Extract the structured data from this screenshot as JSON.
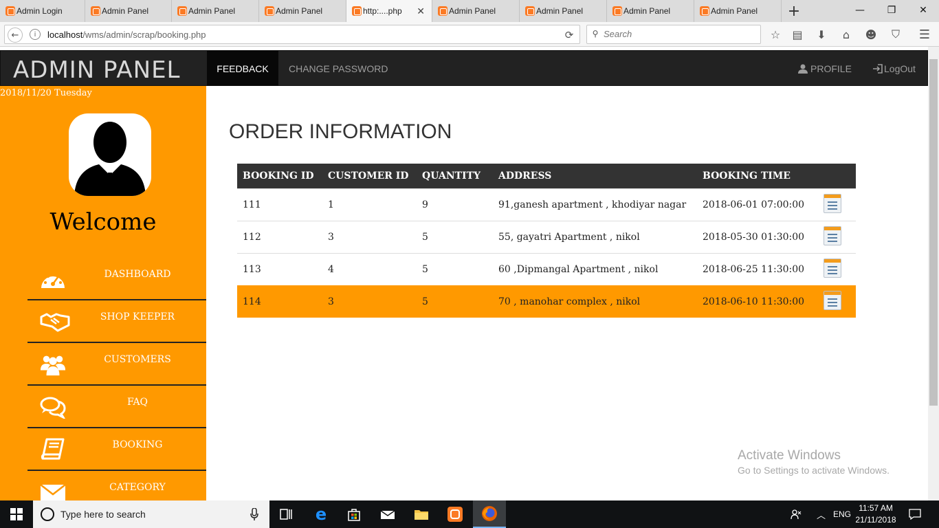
{
  "browser": {
    "tabs": [
      {
        "title": "Admin Login"
      },
      {
        "title": "Admin Panel"
      },
      {
        "title": "Admin Panel"
      },
      {
        "title": "Admin Panel"
      },
      {
        "title": "http:....php",
        "active": true
      },
      {
        "title": "Admin Panel"
      },
      {
        "title": "Admin Panel"
      },
      {
        "title": "Admin Panel"
      },
      {
        "title": "Admin Panel"
      }
    ],
    "url_host": "localhost",
    "url_path": "/wms/admin/scrap/booking.php",
    "search_placeholder": "Search"
  },
  "header": {
    "brand": "ADMIN PANEL",
    "nav": [
      "FEEDBACK",
      "CHANGE PASSWORD"
    ],
    "profile": "PROFILE",
    "logout": "LogOut"
  },
  "sidebar": {
    "date": "2018/11/20  Tuesday",
    "welcome": "Welcome",
    "items": [
      {
        "label": "DASHBOARD",
        "icon": "dashboard-icon"
      },
      {
        "label": "SHOP KEEPER",
        "icon": "handshake-icon"
      },
      {
        "label": "CUSTOMERS",
        "icon": "users-icon"
      },
      {
        "label": "FAQ",
        "icon": "chat-icon"
      },
      {
        "label": "BOOKING",
        "icon": "book-icon"
      },
      {
        "label": "CATEGORY",
        "icon": "envelope-icon"
      }
    ]
  },
  "main": {
    "title": "ORDER INFORMATION",
    "columns": [
      "BOOKING ID",
      "CUSTOMER ID",
      "QUANTITY",
      "ADDRESS",
      "BOOKING TIME"
    ],
    "rows": [
      {
        "booking_id": "111",
        "customer_id": "1",
        "quantity": "9",
        "address": "91,ganesh apartment , khodiyar nagar",
        "time": "2018-06-01 07:00:00"
      },
      {
        "booking_id": "112",
        "customer_id": "3",
        "quantity": "5",
        "address": "55, gayatri Apartment , nikol",
        "time": "2018-05-30 01:30:00"
      },
      {
        "booking_id": "113",
        "customer_id": "4",
        "quantity": "5",
        "address": "60 ,Dipmangal Apartment , nikol",
        "time": "2018-06-25 11:30:00"
      },
      {
        "booking_id": "114",
        "customer_id": "3",
        "quantity": "5",
        "address": "70 , manohar complex , nikol",
        "time": "2018-06-10 11:30:00",
        "highlighted": true
      }
    ],
    "highlight_color": "#ff9900"
  },
  "watermark": {
    "line1": "Activate Windows",
    "line2": "Go to Settings to activate Windows."
  },
  "taskbar": {
    "search_placeholder": "Type here to search",
    "lang": "ENG",
    "time": "11:57 AM",
    "date": "21/11/2018"
  },
  "colors": {
    "accent": "#ff9900",
    "topbar": "#222222",
    "table_header": "#333333"
  }
}
